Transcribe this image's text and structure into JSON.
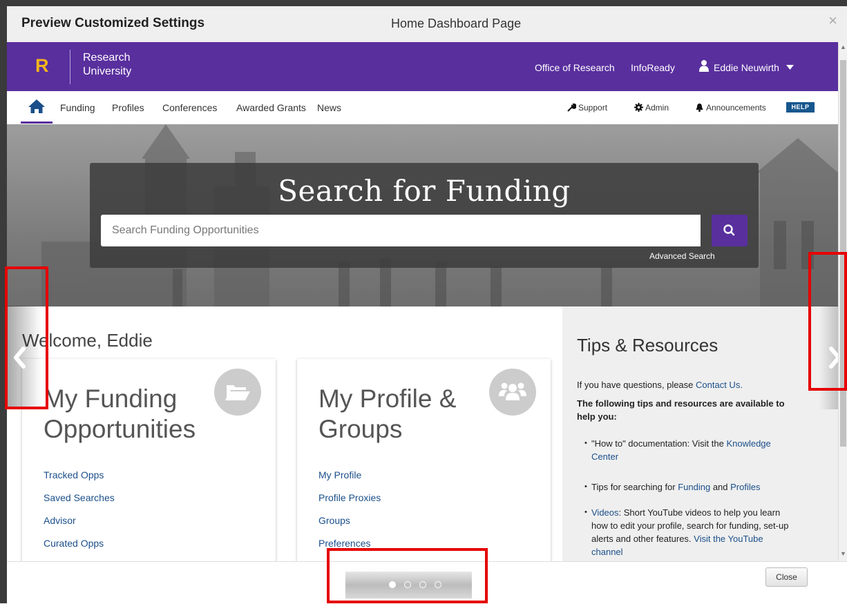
{
  "modal": {
    "title": "Preview Customized Settings",
    "subtitle": "Home Dashboard Page",
    "close_icon": "×",
    "close_label": "Close"
  },
  "brand": {
    "logo_letter": "R",
    "name_line1": "Research",
    "name_line2": "University",
    "colors": {
      "primary": "#592f9e",
      "accent": "#f2b51d",
      "link": "#1b4f8a",
      "highlight": "#e60000"
    }
  },
  "header_links": {
    "office": "Office of Research",
    "infoready": "InfoReady",
    "user_name": "Eddie Neuwirth"
  },
  "nav": {
    "items": [
      "Funding",
      "Profiles",
      "Conferences",
      "Awarded Grants",
      "News"
    ],
    "support": "Support",
    "admin": "Admin",
    "announcements": "Announcements",
    "help": "HELP"
  },
  "hero": {
    "title": "Search for Funding",
    "placeholder": "Search Funding Opportunities",
    "advanced": "Advanced Search"
  },
  "welcome": "Welcome, Eddie",
  "cards": [
    {
      "title_line1": "My Funding",
      "title_line2": "Opportunities",
      "icon": "folder-open-icon",
      "links": [
        "Tracked Opps",
        "Saved Searches",
        "Advisor",
        "Curated Opps"
      ]
    },
    {
      "title_line1": "My Profile &",
      "title_line2": "Groups",
      "icon": "users-icon",
      "links": [
        "My Profile",
        "Profile Proxies",
        "Groups",
        "Preferences"
      ]
    }
  ],
  "tips": {
    "title": "Tips & Resources",
    "intro": "If you have questions, please ",
    "contact": "Contact Us.",
    "bold_line1": "The following tips and resources are available to",
    "bold_line2": "help you:",
    "b1_pre": "\"How to\" documentation: Visit the ",
    "b1_link1": "Knowledge",
    "b1_link2": "Center",
    "b2_pre": "Tips for searching for ",
    "b2_link1": "Funding",
    "b2_mid": " and ",
    "b2_link2": "Profiles",
    "b3_link": "Videos",
    "b3_line1": ": Short YouTube videos to help you learn",
    "b3_line2": "how to edit your profile, search for funding, set-up",
    "b3_line3": "alerts and other features. ",
    "b3_link2": "Visit the YouTube",
    "b3_link3": "channel"
  },
  "carousel": {
    "slides": 4,
    "active": 1
  }
}
